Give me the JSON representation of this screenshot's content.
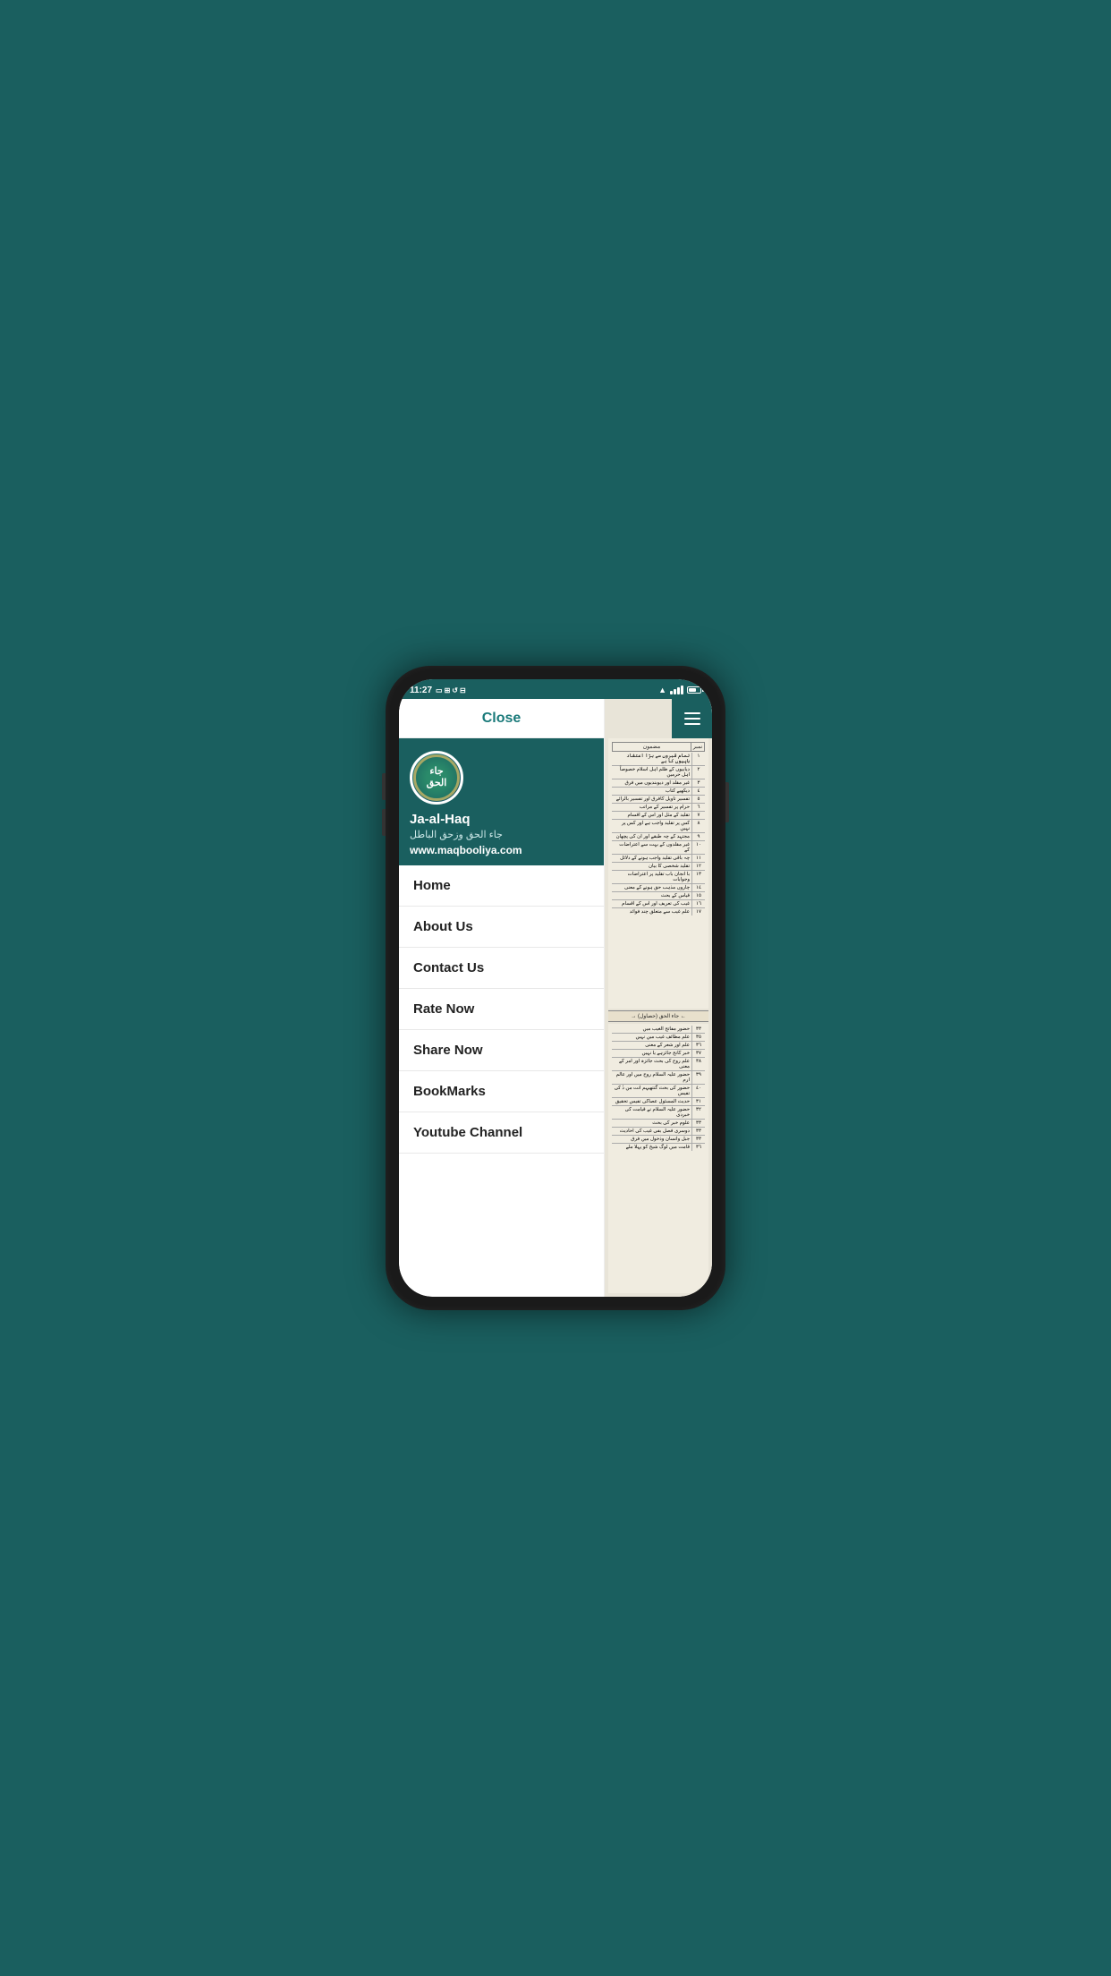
{
  "statusBar": {
    "time": "11:27",
    "battery_level": 70
  },
  "header": {
    "close_label": "Close"
  },
  "appInfo": {
    "name_en": "Ja-al-Haq",
    "name_ar": "جاء الحق وزحق الباطل",
    "url": "www.maqbooliya.com",
    "logo_alt": "Jaa-al-Haq logo"
  },
  "navMenu": {
    "items": [
      {
        "label": "Home",
        "id": "home"
      },
      {
        "label": "About Us",
        "id": "about"
      },
      {
        "label": "Contact Us",
        "id": "contact"
      },
      {
        "label": "Rate Now",
        "id": "rate"
      },
      {
        "label": "Share Now",
        "id": "share"
      },
      {
        "label": "BookMarks",
        "id": "bookmarks"
      },
      {
        "label": "Youtube Channel",
        "id": "youtube"
      }
    ]
  },
  "bookContent": {
    "table1_title": "مضمون",
    "table1_rows": [
      {
        "num": "١",
        "text": "تمام قبروں سے بڑا اعتقاد باپیوں کا ہے"
      },
      {
        "num": "٢",
        "text": "دیابیوں کے ظلم اہل اسلام خصوصاً اہل حرمین"
      },
      {
        "num": "٣",
        "text": "غیر مقلد اور دیوبندیوں میں فرق"
      },
      {
        "num": "٤",
        "text": "دیکھیے کتاب"
      },
      {
        "num": "٥",
        "text": "تفسیر تاویل کافرق اور تفسیر بالرائے"
      },
      {
        "num": "٦",
        "text": "حرام پر تفسیر کے مراتب"
      },
      {
        "num": "٧",
        "text": "تقلید کے مثل اور اس کے اقسام"
      },
      {
        "num": "٨",
        "text": "کس پر تقلید واجب ہے اور کس پر نہیں"
      },
      {
        "num": "٩",
        "text": "مجتہد کے چہ طبقے اور ان کی پچھان"
      },
      {
        "num": "١٠",
        "text": "غیر مقلدوں کے بہت سے اعتراضات کے"
      },
      {
        "num": "١١",
        "text": "چہ باقی تقلید واجب ہونے کے دلائل"
      },
      {
        "num": "١٢",
        "text": "تقلید شخصی کا بیان"
      },
      {
        "num": "١٣",
        "text": "با انجان باب تقلید پر اعتراضات وجوابات"
      },
      {
        "num": "١٤",
        "text": "چاروں مذہب حق ہونے کے معنی"
      },
      {
        "num": "١٥",
        "text": "قیاس کے بحث"
      },
      {
        "num": "١٦",
        "text": "غیب کی تعریف اور اس کے اقسام"
      },
      {
        "num": "١٧",
        "text": "علم غیب سے متعلق چند فوائد"
      }
    ],
    "divider_text": "جاء الحق (حصاول)",
    "table2_rows": [
      {
        "num": "٣٣",
        "text": "حضور مفاتح الغیب میں"
      },
      {
        "num": "٣٥",
        "text": "علم مطائف غیب میں نہیں"
      },
      {
        "num": "٣٦",
        "text": "علم اور شعر کے معنی"
      },
      {
        "num": "٣٧",
        "text": "خبر کانح جائزہے یا نہیں"
      },
      {
        "num": "٣٨",
        "text": "علم روح کی بحث جائزہ اور امر کے معنی"
      },
      {
        "num": "٣٩",
        "text": "حضور علیہ السلام روح میں اور عالم ارم"
      },
      {
        "num": "٤٠",
        "text": "حضور کی بحث گنتھیہم انت من ذٰ کی تفیس تو بجھی"
      },
      {
        "num": "٣١",
        "text": "حدیث المسئول عصاکی تفیس تحقیق"
      },
      {
        "num": "٣٢",
        "text": "حضور علیہ السلام نے قیامت کی خبردی"
      },
      {
        "num": "٣٣",
        "text": "علوم خبر کی بحث"
      },
      {
        "num": "٣٣",
        "text": "دوسری فصل بفی غیب کی احادیث"
      },
      {
        "num": "٣٣",
        "text": "جبل وانسان وذخول میں فرق"
      },
      {
        "num": "٣٦",
        "text": "قامت میں لوگ شیخ کو پہلا ملے"
      }
    ]
  }
}
